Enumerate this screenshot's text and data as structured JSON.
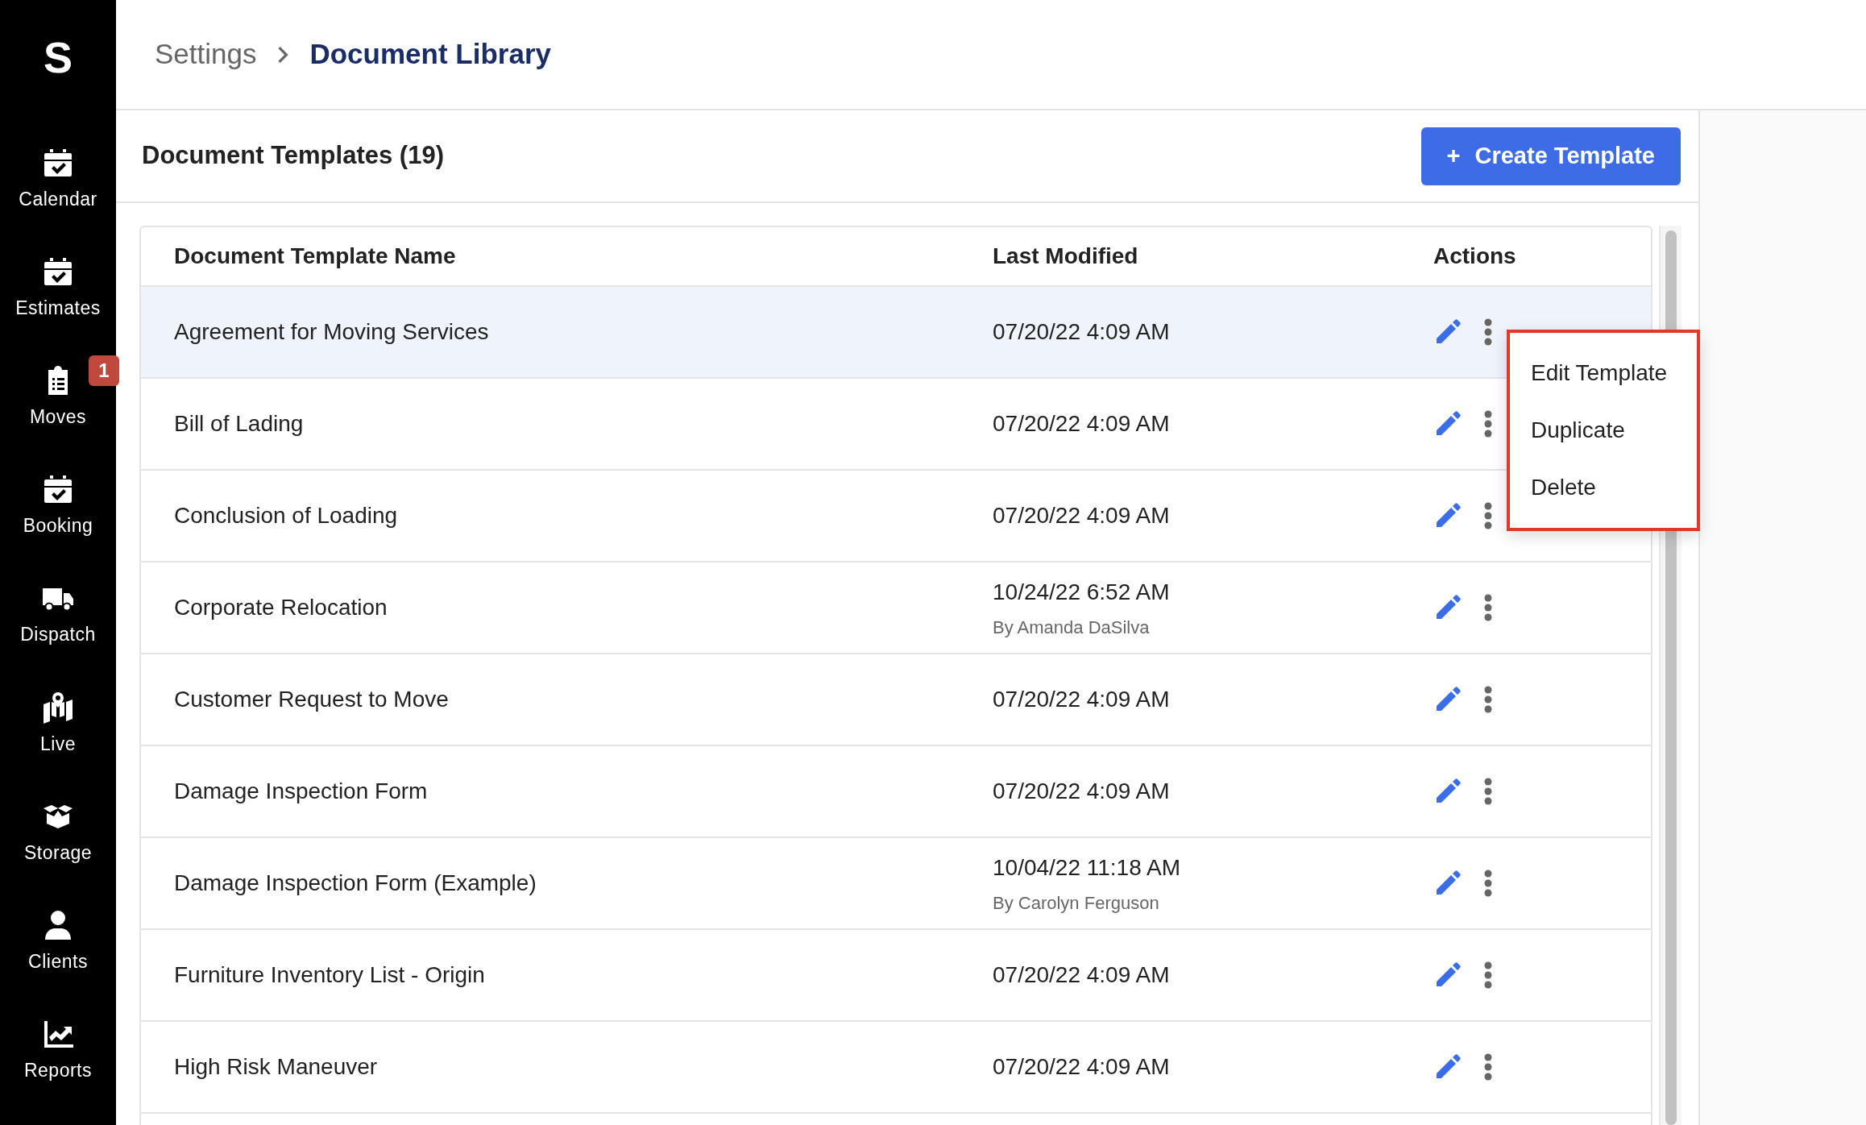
{
  "sidebar": {
    "logo": "S",
    "items": [
      {
        "label": "Calendar"
      },
      {
        "label": "Estimates"
      },
      {
        "label": "Moves",
        "badge": "1"
      },
      {
        "label": "Booking"
      },
      {
        "label": "Dispatch"
      },
      {
        "label": "Live"
      },
      {
        "label": "Storage"
      },
      {
        "label": "Clients"
      },
      {
        "label": "Reports"
      }
    ]
  },
  "breadcrumb": [
    "Settings",
    "Document Library"
  ],
  "panel": {
    "title": "Document Templates (19)",
    "button": "Create Template",
    "button_icon": "+"
  },
  "table": {
    "columns": [
      "Document Template Name",
      "Last Modified",
      "Actions"
    ],
    "rows": [
      {
        "name": "Agreement for Moving Services",
        "modified": "07/20/22 4:09 AM",
        "selected": true
      },
      {
        "name": "Bill of Lading",
        "modified": "07/20/22 4:09 AM",
        "selected": false
      },
      {
        "name": "Conclusion of Loading",
        "modified": "07/20/22 4:09 AM",
        "selected": false
      },
      {
        "name": "Corporate Relocation",
        "modified": "10/24/22 6:52 AM",
        "by": "By Amanda DaSilva",
        "selected": false
      },
      {
        "name": "Customer Request to Move",
        "modified": "07/20/22 4:09 AM",
        "selected": false
      },
      {
        "name": "Damage Inspection Form",
        "modified": "07/20/22 4:09 AM",
        "selected": false
      },
      {
        "name": "Damage Inspection Form (Example)",
        "modified": "10/04/22 11:18 AM",
        "by": "By Carolyn Ferguson",
        "selected": false
      },
      {
        "name": "Furniture Inventory List - Origin",
        "modified": "07/20/22 4:09 AM",
        "selected": false
      },
      {
        "name": "High Risk Maneuver",
        "modified": "07/20/22 4:09 AM",
        "selected": false
      }
    ]
  },
  "menu": {
    "items": [
      "Edit Template",
      "Duplicate",
      "Delete"
    ]
  }
}
